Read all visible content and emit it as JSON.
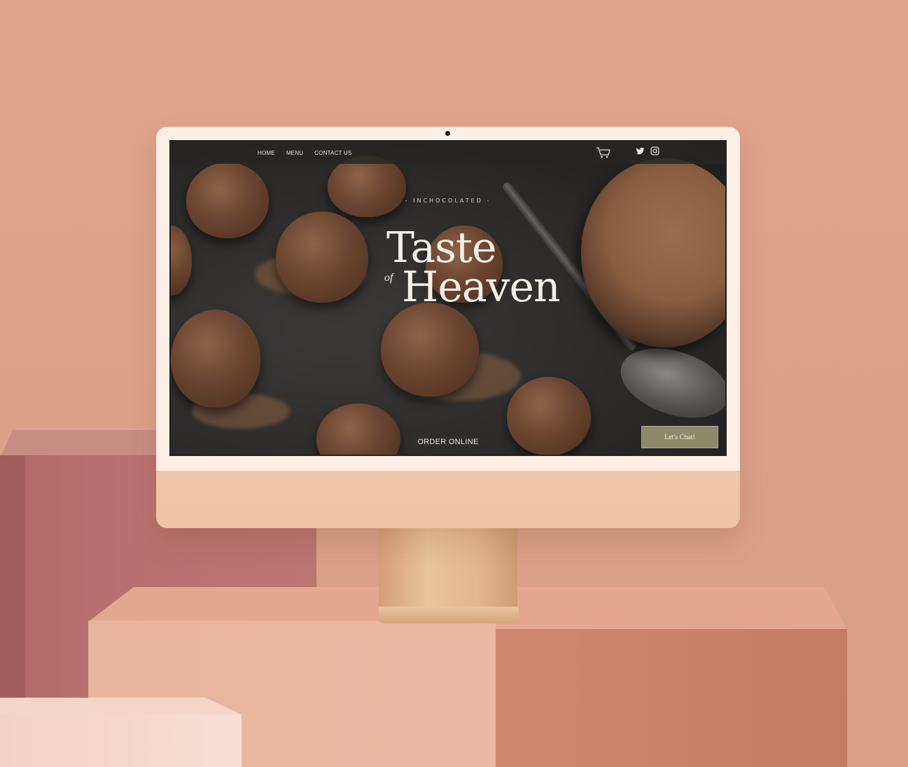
{
  "nav": {
    "links": [
      "HOME",
      "MENU",
      "CONTACT US"
    ]
  },
  "icons": {
    "cart": "cart-icon",
    "twitter": "twitter-icon",
    "instagram": "instagram-icon"
  },
  "hero": {
    "kicker": "- INCHOCOLATED -",
    "title_line1": "Taste",
    "title_of": "of",
    "title_line2": "Heaven",
    "order_link": "ORDER ONLINE"
  },
  "chat": {
    "label": "Let's Chat!"
  },
  "colors": {
    "chat_button": "#8d8a6c",
    "navbar": "#282624",
    "background": "#dca189"
  }
}
